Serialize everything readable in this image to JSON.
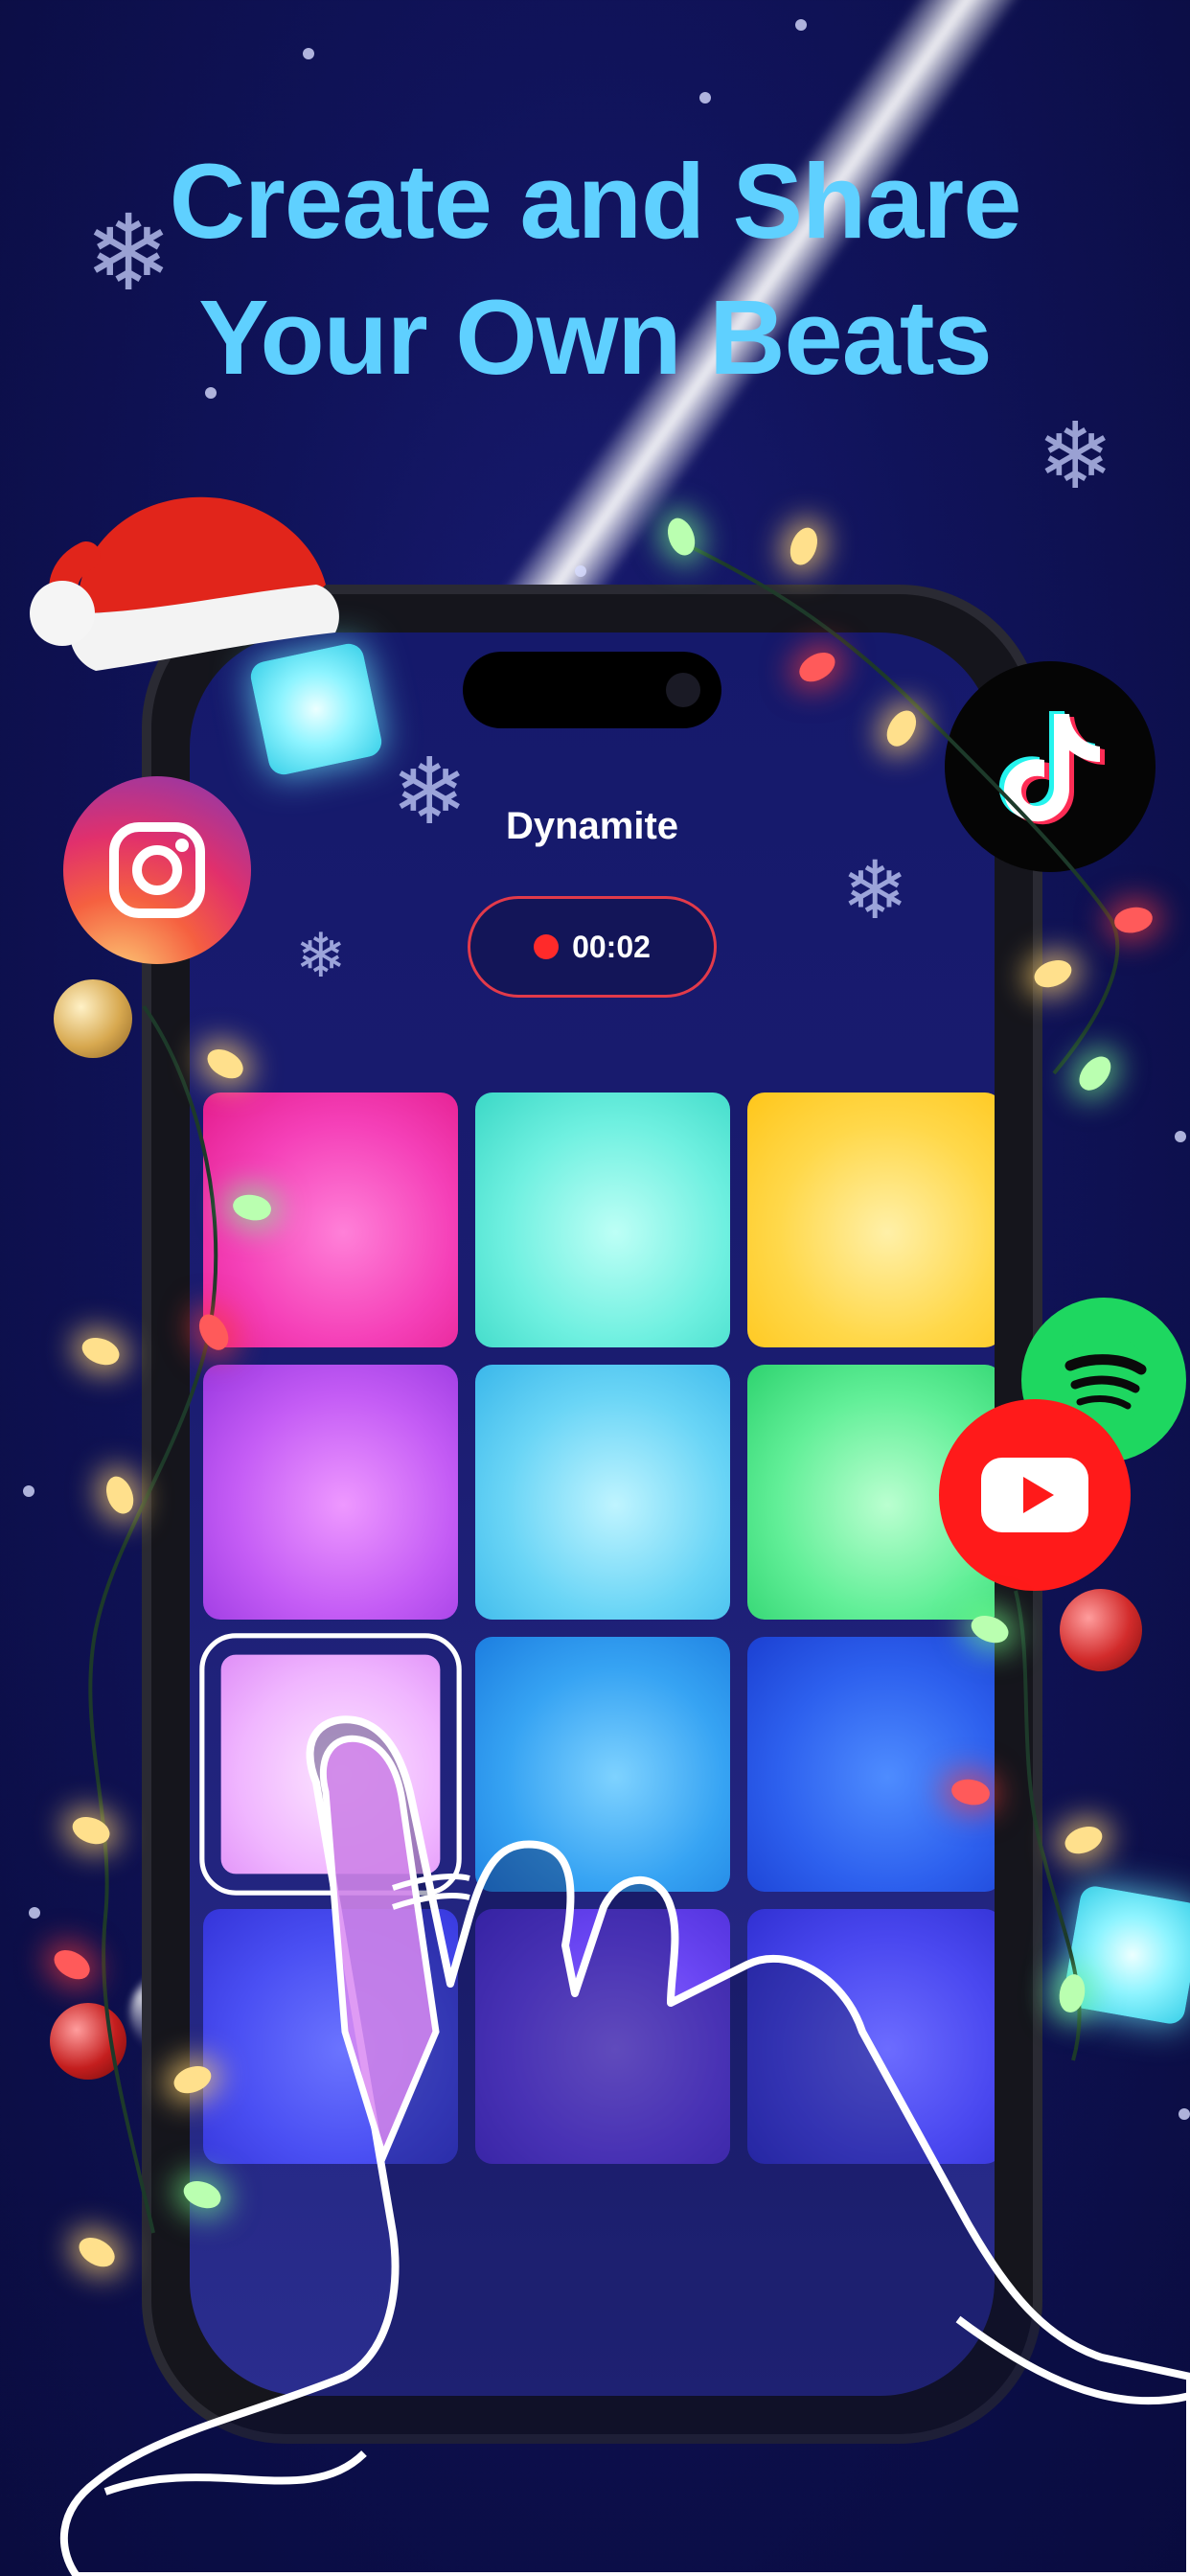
{
  "headline": {
    "line1": "Create and Share",
    "line2": "Your Own Beats"
  },
  "screen": {
    "song_title": "Dynamite",
    "timer": "00:02",
    "pads": [
      {
        "color": "pink"
      },
      {
        "color": "teal"
      },
      {
        "color": "yellow"
      },
      {
        "color": "purple"
      },
      {
        "color": "cyan"
      },
      {
        "color": "green"
      },
      {
        "color": "lilac",
        "pressed": true
      },
      {
        "color": "blue"
      },
      {
        "color": "blue"
      },
      {
        "color": "indigo"
      },
      {
        "color": "indigo"
      },
      {
        "color": "indigo"
      }
    ]
  },
  "social_icons": [
    "instagram-icon",
    "tiktok-icon",
    "spotify-icon",
    "youtube-icon"
  ],
  "colors": {
    "background": "#10135a",
    "headline": "#5fd0ff",
    "record": "#ff2a2a"
  }
}
